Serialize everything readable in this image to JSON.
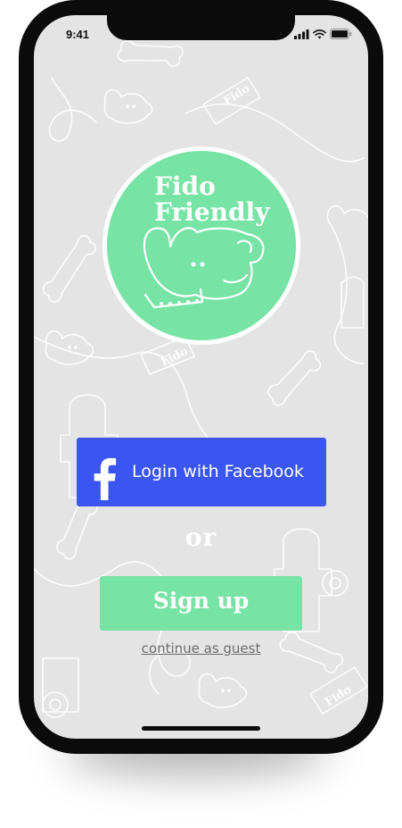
{
  "status_bar": {
    "time": "9:41",
    "icons": [
      "signal-icon",
      "wifi-icon",
      "battery-icon"
    ]
  },
  "logo": {
    "line1": "Fido",
    "line2": "Friendly",
    "circle_color": "#77e3a5",
    "icon": "dog-head-icon"
  },
  "background": {
    "pattern_label": "Fido",
    "color": "#e4e4e4"
  },
  "facebook_button": {
    "label": "Login with Facebook",
    "icon": "facebook-f-icon",
    "color": "#3b55f2"
  },
  "separator": {
    "label": "or"
  },
  "signup_button": {
    "label": "Sign up",
    "color": "#77e3a5"
  },
  "guest_link": {
    "label": "continue as guest"
  }
}
